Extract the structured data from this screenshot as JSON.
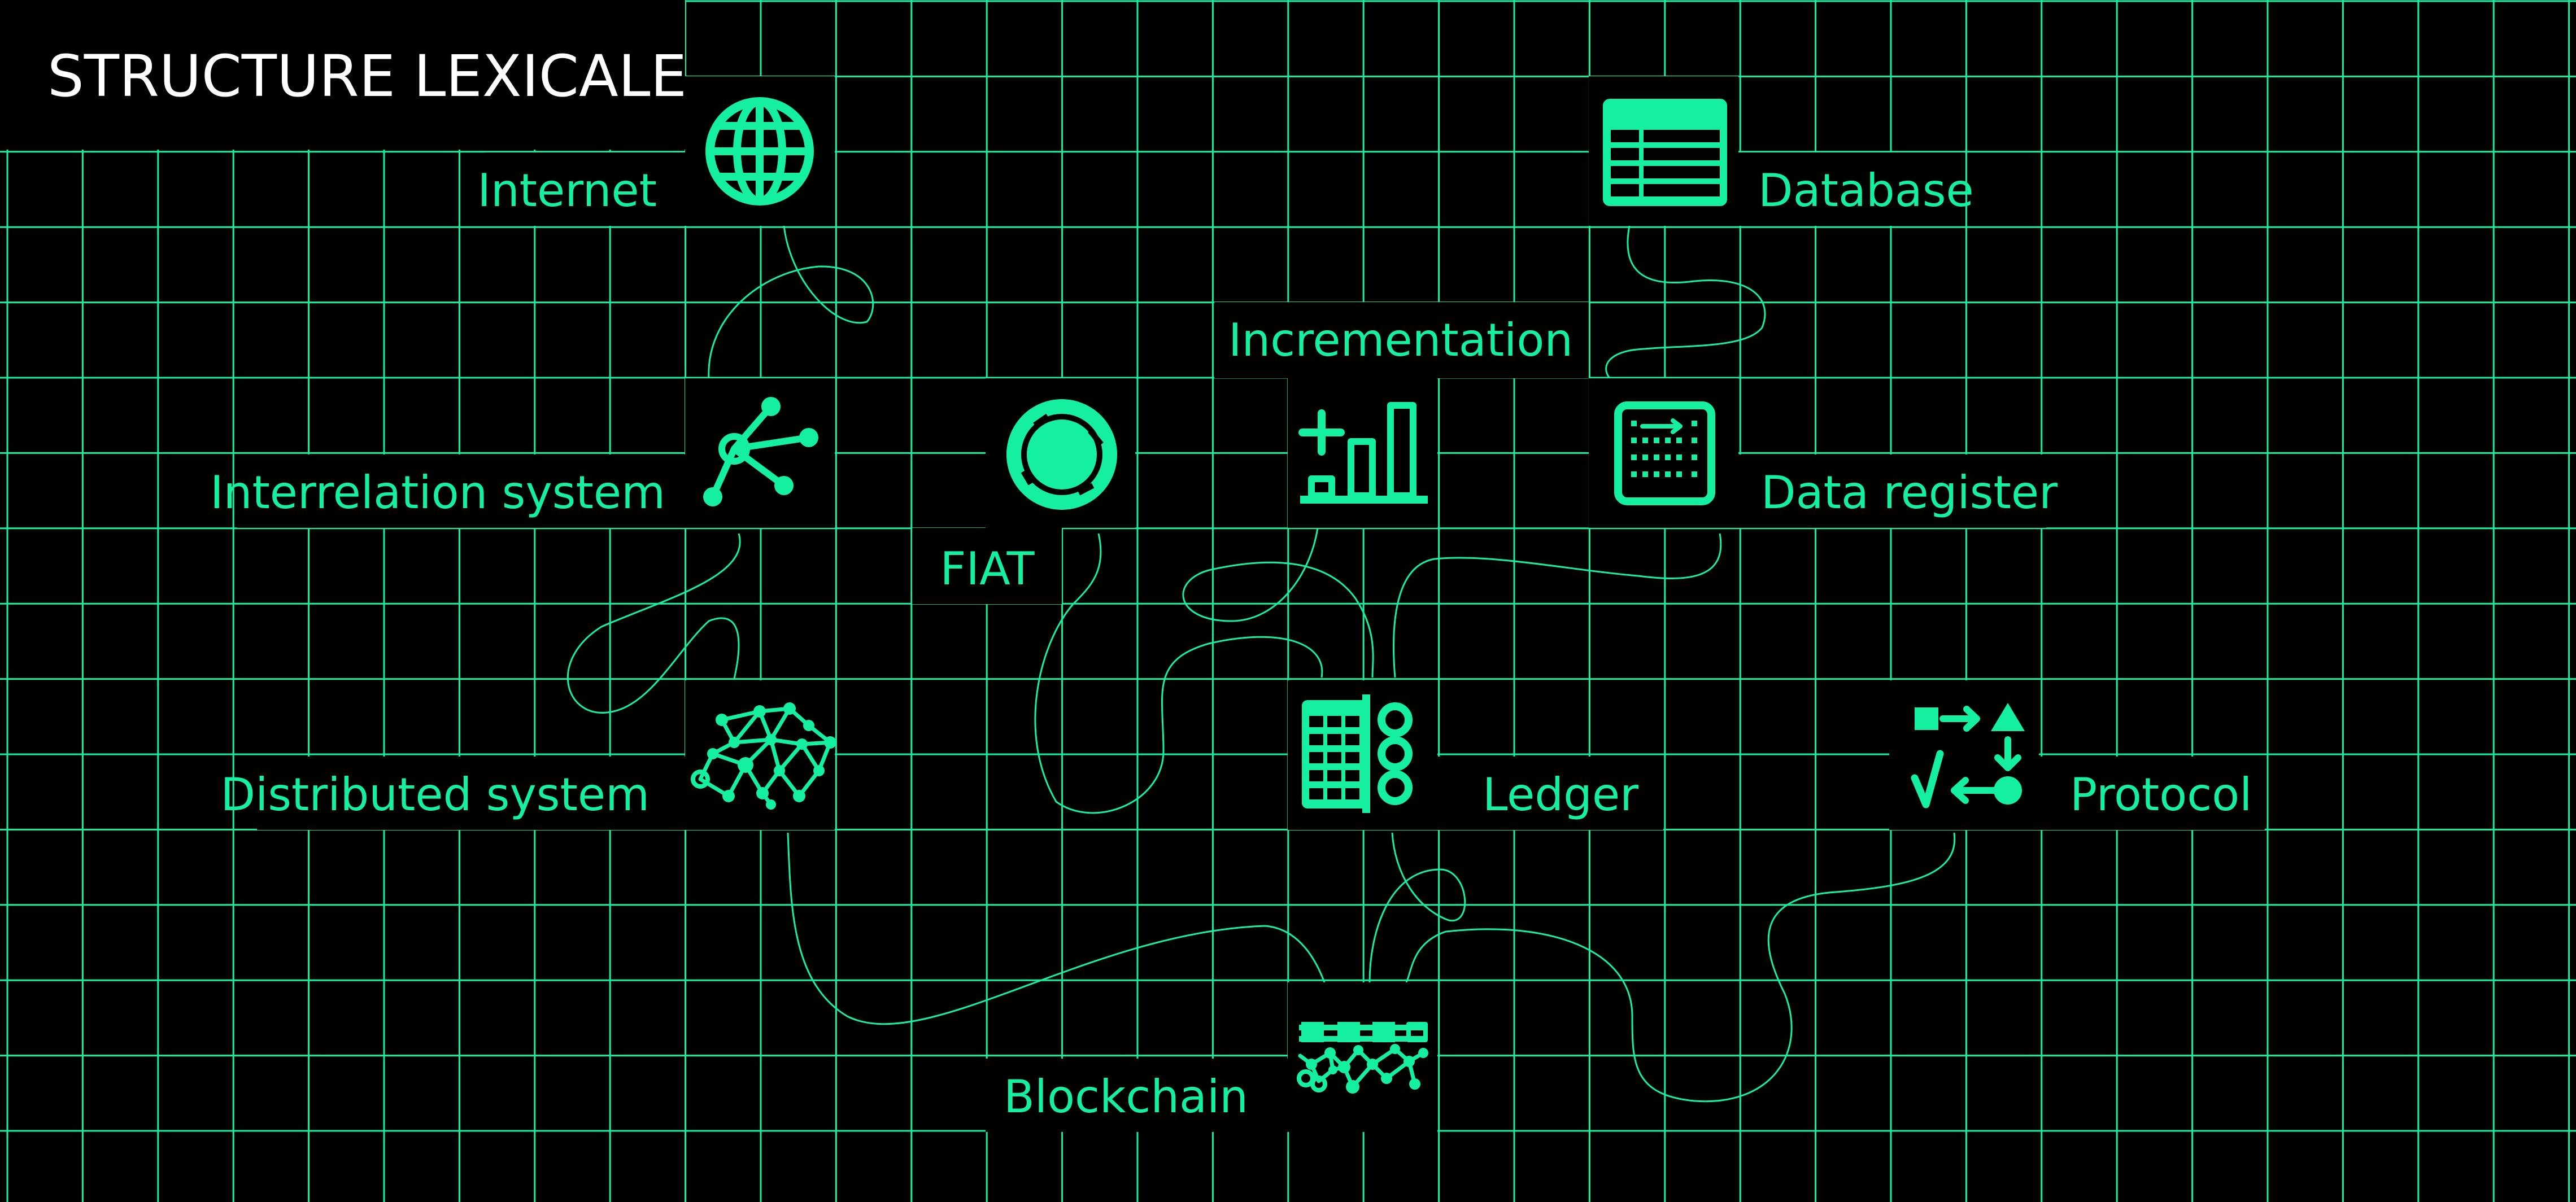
{
  "title": "STRUCTURE LEXICALE",
  "colors": {
    "accent": "#14f0a0",
    "grid": "#14f0a0",
    "background": "#000000",
    "title": "#ffffff"
  },
  "nodes": [
    {
      "id": "internet",
      "label": "Internet",
      "icon": "globe-icon"
    },
    {
      "id": "database",
      "label": "Database",
      "icon": "table-icon"
    },
    {
      "id": "incrementation",
      "label": "Incrementation",
      "icon": "bar-chart-plus-icon"
    },
    {
      "id": "interrelation",
      "label": "Interrelation system",
      "icon": "network-hub-icon"
    },
    {
      "id": "fiat",
      "label": "FIAT",
      "icon": "coin-icon"
    },
    {
      "id": "data-register",
      "label": "Data register",
      "icon": "register-panel-icon"
    },
    {
      "id": "distributed",
      "label": "Distributed system",
      "icon": "mesh-network-icon"
    },
    {
      "id": "ledger",
      "label": "Ledger",
      "icon": "ledger-icon"
    },
    {
      "id": "protocol",
      "label": "Protocol",
      "icon": "protocol-icon"
    },
    {
      "id": "blockchain",
      "label": "Blockchain",
      "icon": "blockchain-icon"
    }
  ]
}
